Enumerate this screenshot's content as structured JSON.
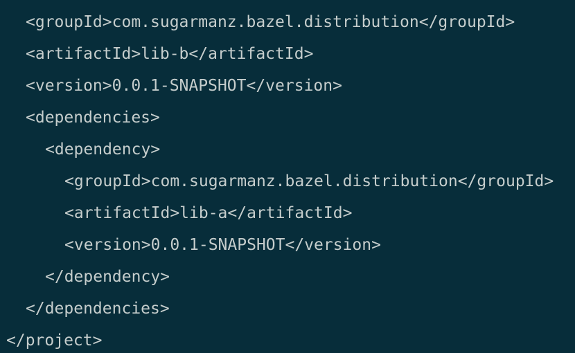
{
  "code": {
    "lines": [
      "<groupId>com.sugarmanz.bazel.distribution</groupId>",
      "<artifactId>lib-b</artifactId>",
      "<version>0.0.1-SNAPSHOT</version>",
      "<dependencies>",
      "<dependency>",
      "<groupId>com.sugarmanz.bazel.distribution</groupId>",
      "<artifactId>lib-a</artifactId>",
      "<version>0.0.1-SNAPSHOT</version>",
      "</dependency>",
      "</dependencies>",
      "</project>"
    ],
    "colors": {
      "background": "#072d3a",
      "text": "#c5cdcc"
    }
  }
}
